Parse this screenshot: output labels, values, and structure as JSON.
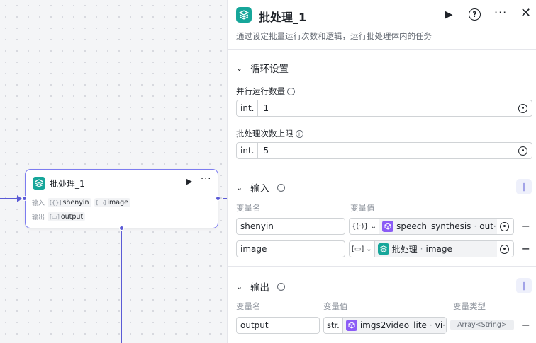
{
  "colors": {
    "accent": "#5b5bd6",
    "node_icon": "#16a69a",
    "plugin_icon": "#8b5cf6"
  },
  "node": {
    "title": "批处理_1",
    "input_label": "输入",
    "output_label": "输出",
    "inputs": [
      {
        "icon": "array-braces-icon",
        "name": "shenyin"
      },
      {
        "icon": "image-icon",
        "name": "image"
      }
    ],
    "outputs": [
      {
        "icon": "array-image-icon",
        "name": "output"
      }
    ]
  },
  "panel": {
    "title": "批处理_1",
    "description": "通过设定批量运行次数和逻辑，运行批处理体内的任务",
    "loop_section": "循环设置",
    "parallel_label": "并行运行数量",
    "parallel_type": "int.",
    "parallel_value": "1",
    "limit_label": "批处理次数上限",
    "limit_type": "int.",
    "limit_value": "5",
    "input_section": "输入",
    "col_var_name": "变量名",
    "col_var_value": "变量值",
    "inputs": [
      {
        "name": "shenyin",
        "type_icon": "{(·)}",
        "ref_node": "speech_synthesis",
        "ref_sep": " · ",
        "ref_var": "out···"
      },
      {
        "name": "image",
        "type_icon": "[▭]",
        "ref_node": "批处理",
        "ref_sep": " · ",
        "ref_var": "image"
      }
    ],
    "output_section": "输出",
    "col_out_name": "变量名",
    "col_out_value": "变量值",
    "col_out_type": "变量类型",
    "outputs": [
      {
        "name": "output",
        "type": "str.",
        "ref_node": "imgs2video_lite",
        "ref_sep": " · ",
        "ref_var": "vi···",
        "var_type": "Array<String>"
      }
    ]
  }
}
